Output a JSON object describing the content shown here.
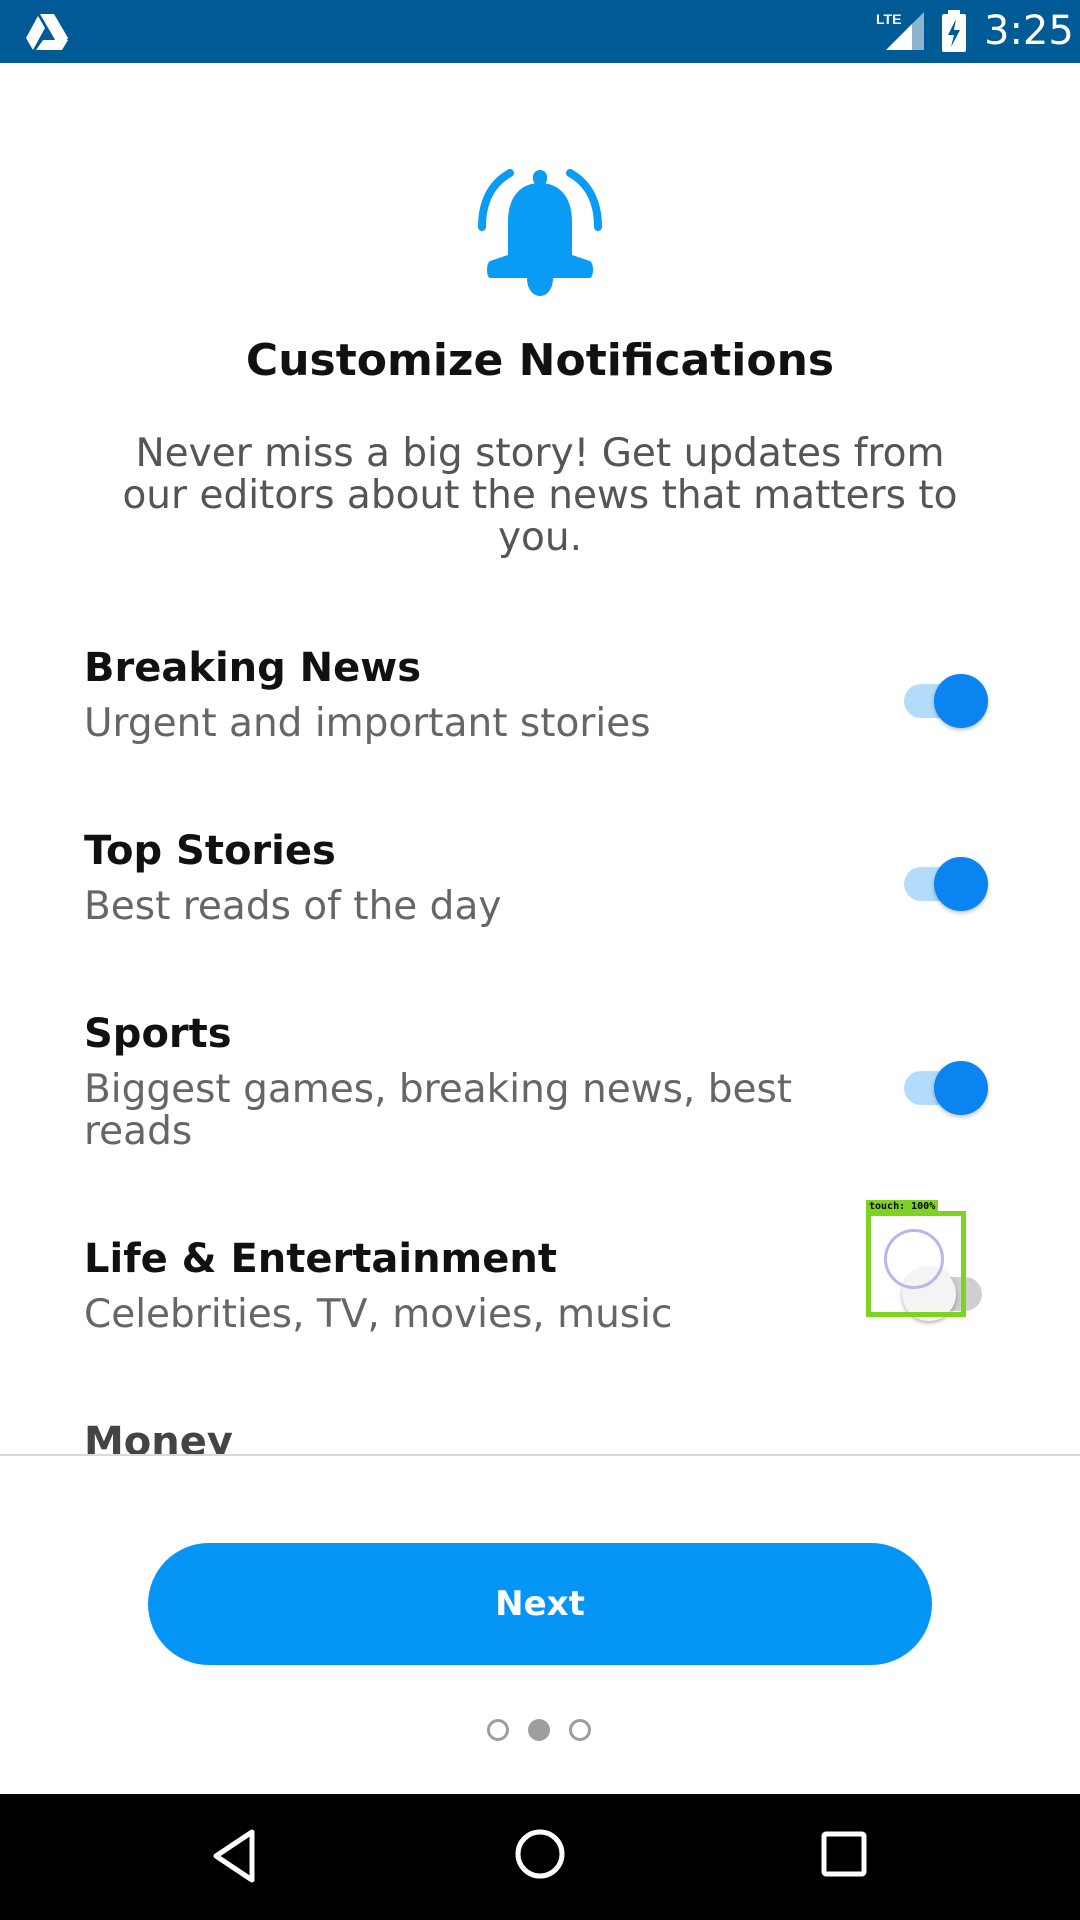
{
  "status_bar": {
    "network": "LTE",
    "time": "3:25",
    "icons": [
      "drive-logo-icon",
      "lte-signal-icon",
      "battery-charging-icon"
    ]
  },
  "header": {
    "icon": "bell-icon",
    "title": "Customize Notifications",
    "description": "Never miss a big story! Get updates from our editors about the news that matters to you."
  },
  "options": [
    {
      "title": "Breaking News",
      "description": "Urgent and important stories",
      "enabled": true
    },
    {
      "title": "Top Stories",
      "description": "Best reads of the day",
      "enabled": true
    },
    {
      "title": "Sports",
      "description": "Biggest games, breaking news, best reads",
      "enabled": true
    },
    {
      "title": "Life & Entertainment",
      "description": "Celebrities, TV, movies, music",
      "enabled": false
    },
    {
      "title": "Money",
      "description": "",
      "enabled": false
    }
  ],
  "touch_overlay": {
    "label": "touch: 100%"
  },
  "footer": {
    "next_label": "Next",
    "pager": {
      "total": 3,
      "current": 2
    }
  },
  "nav_bar": {
    "icons": [
      "back-icon",
      "home-icon",
      "recents-icon"
    ]
  },
  "colors": {
    "status_bar": "#005a96",
    "accent": "#0596f5",
    "toggle_on": "#0a84f0",
    "touch_overlay": "#7ed321"
  }
}
